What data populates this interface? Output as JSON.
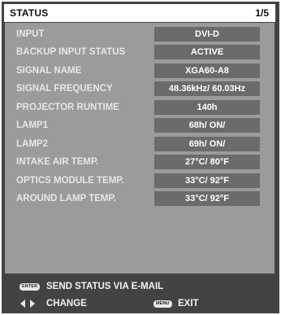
{
  "header": {
    "title": "STATUS",
    "page": "1/5"
  },
  "status_rows": [
    {
      "label": "INPUT",
      "value": "DVI-D"
    },
    {
      "label": "BACKUP INPUT STATUS",
      "value": "ACTIVE"
    },
    {
      "label": "SIGNAL NAME",
      "value": "XGA60-A8"
    },
    {
      "label": "SIGNAL FREQUENCY",
      "value": "48.36kHz/ 60.03Hz"
    },
    {
      "label": "PROJECTOR RUNTIME",
      "value": "140h"
    },
    {
      "label": "LAMP1",
      "value": "68h/ ON/"
    },
    {
      "label": "LAMP2",
      "value": "69h/ ON/"
    },
    {
      "label": "INTAKE AIR TEMP.",
      "value": "27°C/ 80°F"
    },
    {
      "label": "OPTICS MODULE TEMP.",
      "value": "33°C/ 92°F"
    },
    {
      "label": "AROUND LAMP TEMP.",
      "value": "33°C/ 92°F"
    }
  ],
  "footer": {
    "enter_badge": "ENTER",
    "send_status": "SEND STATUS VIA E-MAIL",
    "change": "CHANGE",
    "menu_badge": "MENU",
    "exit": "EXIT"
  },
  "icons": {
    "change_arrows": "left-right-arrows-icon"
  },
  "colors": {
    "frame": "#434343",
    "panel": "#9b9b9b",
    "value_box": "#6b6b6b",
    "label_text": "#e6e6e6",
    "title_bg": "#ffffff"
  }
}
